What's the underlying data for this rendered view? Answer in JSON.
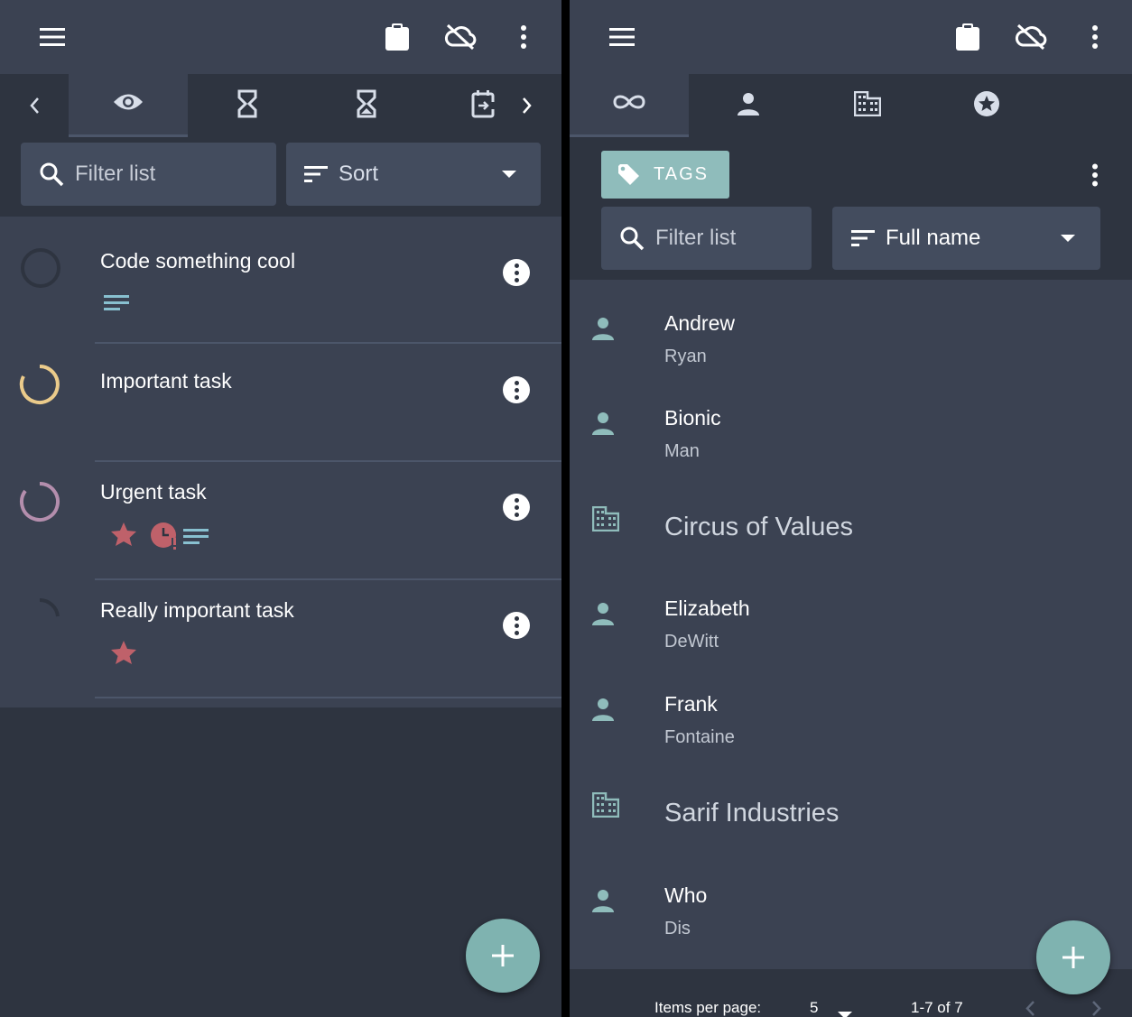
{
  "left": {
    "toolbar": {
      "menu_icon": "menu-icon",
      "clipboard_icon": "clipboard-icon",
      "cloud_icon": "cloud-off-icon",
      "more_icon": "more-vert-icon"
    },
    "tabs": [
      "chevron-left-icon",
      "eye-icon",
      "hourglass-empty-icon",
      "hourglass-half-icon",
      "calendar-export-icon",
      "chevron-right-icon"
    ],
    "filter": {
      "placeholder": "Filter list"
    },
    "sort": {
      "label": "Sort"
    },
    "tasks": [
      {
        "title": "Code something cool",
        "progress_color": "#2e3440",
        "icons": [
          "notes-icon"
        ]
      },
      {
        "title": "Important task",
        "progress_color": "#ebcb8b",
        "icons": []
      },
      {
        "title": "Urgent task",
        "progress_color": "#b48ead",
        "icons": [
          "star-icon",
          "overdue-clock-icon",
          "notes-icon"
        ]
      },
      {
        "title": "Really important task",
        "progress_color": "#2e3440",
        "icons": [
          "star-icon"
        ]
      }
    ]
  },
  "right": {
    "tabs": [
      "all-loop-icon",
      "person-icon",
      "business-icon",
      "star-circle-icon"
    ],
    "tags_button": {
      "label": "TAGS"
    },
    "filter": {
      "placeholder": "Filter list"
    },
    "sort": {
      "label": "Full name"
    },
    "contacts": [
      {
        "type": "person",
        "first": "Andrew",
        "last": "Ryan"
      },
      {
        "type": "person",
        "first": "Bionic",
        "last": "Man"
      },
      {
        "type": "organization",
        "name": "Circus of Values"
      },
      {
        "type": "person",
        "first": "Elizabeth",
        "last": "DeWitt"
      },
      {
        "type": "person",
        "first": "Frank",
        "last": "Fontaine"
      },
      {
        "type": "organization",
        "name": "Sarif Industries"
      },
      {
        "type": "person",
        "first": "Who",
        "last": "Dis"
      }
    ],
    "paginator": {
      "items_per_page_label": "Items per page:",
      "items_per_page_value": "5",
      "range_label": "1-7 of 7"
    }
  },
  "colors": {
    "background": "#2e3440",
    "surface": "#3b4252",
    "field": "#434c5e",
    "accent": "#7fb3b0",
    "star": "#bf616a",
    "icon_teal": "#88c0d0"
  }
}
